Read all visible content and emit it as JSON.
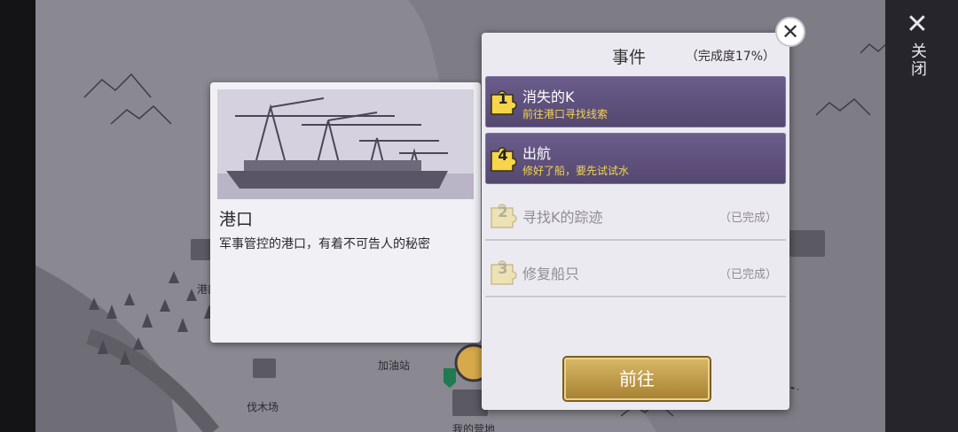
{
  "map": {
    "labels": {
      "port": "港口",
      "gas_station": "加油站",
      "lumber_yard": "伐木场",
      "my_camp": "我的营地"
    }
  },
  "side": {
    "close_label": "关闭",
    "close_icon": "close-icon"
  },
  "location": {
    "title": "港口",
    "description": "军事管控的港口，有着不可告人的秘密"
  },
  "panel": {
    "title": "事件",
    "progress": "（完成度17%）",
    "events": [
      {
        "num": "1",
        "name": "消失的K",
        "subtitle": "前往港口寻找线索",
        "state": "active"
      },
      {
        "num": "4",
        "name": "出航",
        "subtitle": "修好了船，要先试试水",
        "state": "active"
      },
      {
        "num": "2",
        "name": "寻找K的踪迹",
        "status": "（已完成）",
        "state": "done"
      },
      {
        "num": "3",
        "name": "修复船只",
        "status": "（已完成）",
        "state": "done"
      }
    ],
    "go_button": "前往"
  },
  "colors": {
    "active_event": "#5f5280",
    "subtitle": "#f3d54d",
    "gold_button": "#c4a04f"
  }
}
